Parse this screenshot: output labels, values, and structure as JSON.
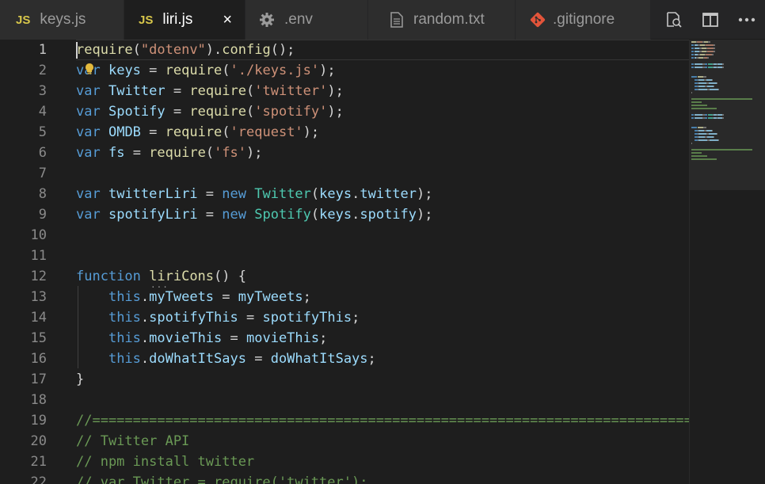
{
  "tabs": [
    {
      "label": "keys.js",
      "icon": "js-icon",
      "icon_text": "JS",
      "active": false
    },
    {
      "label": "liri.js",
      "icon": "js-icon",
      "icon_text": "JS",
      "active": true,
      "close_glyph": "×"
    },
    {
      "label": ".env",
      "icon": "gear-icon",
      "active": false
    },
    {
      "label": "random.txt",
      "icon": "file-text-icon",
      "active": false
    },
    {
      "label": ".gitignore",
      "icon": "git-icon",
      "active": false
    }
  ],
  "actions": [
    {
      "name": "open-changes-icon"
    },
    {
      "name": "split-editor-icon"
    },
    {
      "name": "more-actions-icon"
    }
  ],
  "colors": {
    "keyword": "#569cd6",
    "function": "#dcdcaa",
    "string": "#ce9178",
    "variable": "#9cdcfe",
    "class": "#4ec9b0",
    "comment": "#6a9955",
    "text": "#d4d4d4"
  },
  "editor": {
    "lines": [
      {
        "n": "1",
        "tokens": [
          [
            "fn",
            "require"
          ],
          [
            "pun",
            "("
          ],
          [
            "str",
            "\"dotenv\""
          ],
          [
            "pun",
            ")."
          ],
          [
            "fn",
            "config"
          ],
          [
            "pun",
            "();"
          ]
        ]
      },
      {
        "n": "2",
        "tokens": [
          [
            "kw",
            "var"
          ],
          [
            "pun",
            " "
          ],
          [
            "var",
            "keys"
          ],
          [
            "pun",
            " = "
          ],
          [
            "fn",
            "require"
          ],
          [
            "pun",
            "("
          ],
          [
            "str",
            "'./keys.js'"
          ],
          [
            "pun",
            ");"
          ]
        ]
      },
      {
        "n": "3",
        "tokens": [
          [
            "kw",
            "var"
          ],
          [
            "pun",
            " "
          ],
          [
            "var",
            "Twitter"
          ],
          [
            "pun",
            " = "
          ],
          [
            "fn",
            "require"
          ],
          [
            "pun",
            "("
          ],
          [
            "str",
            "'twitter'"
          ],
          [
            "pun",
            ");"
          ]
        ]
      },
      {
        "n": "4",
        "tokens": [
          [
            "kw",
            "var"
          ],
          [
            "pun",
            " "
          ],
          [
            "var",
            "Spotify"
          ],
          [
            "pun",
            " = "
          ],
          [
            "fn",
            "require"
          ],
          [
            "pun",
            "("
          ],
          [
            "str",
            "'spotify'"
          ],
          [
            "pun",
            ");"
          ]
        ]
      },
      {
        "n": "5",
        "tokens": [
          [
            "kw",
            "var"
          ],
          [
            "pun",
            " "
          ],
          [
            "var",
            "OMDB"
          ],
          [
            "pun",
            " = "
          ],
          [
            "fn",
            "require"
          ],
          [
            "pun",
            "("
          ],
          [
            "str",
            "'request'"
          ],
          [
            "pun",
            ");"
          ]
        ]
      },
      {
        "n": "6",
        "tokens": [
          [
            "kw",
            "var"
          ],
          [
            "pun",
            " "
          ],
          [
            "var",
            "fs"
          ],
          [
            "pun",
            " = "
          ],
          [
            "fn",
            "require"
          ],
          [
            "pun",
            "("
          ],
          [
            "str",
            "'fs'"
          ],
          [
            "pun",
            ");"
          ]
        ]
      },
      {
        "n": "7",
        "tokens": []
      },
      {
        "n": "8",
        "tokens": [
          [
            "kw",
            "var"
          ],
          [
            "pun",
            " "
          ],
          [
            "var",
            "twitterLiri"
          ],
          [
            "pun",
            " = "
          ],
          [
            "kw",
            "new"
          ],
          [
            "pun",
            " "
          ],
          [
            "cls",
            "Twitter"
          ],
          [
            "pun",
            "("
          ],
          [
            "var",
            "keys"
          ],
          [
            "pun",
            "."
          ],
          [
            "var",
            "twitter"
          ],
          [
            "pun",
            ");"
          ]
        ]
      },
      {
        "n": "9",
        "tokens": [
          [
            "kw",
            "var"
          ],
          [
            "pun",
            " "
          ],
          [
            "var",
            "spotifyLiri"
          ],
          [
            "pun",
            " = "
          ],
          [
            "kw",
            "new"
          ],
          [
            "pun",
            " "
          ],
          [
            "cls",
            "Spotify"
          ],
          [
            "pun",
            "("
          ],
          [
            "var",
            "keys"
          ],
          [
            "pun",
            "."
          ],
          [
            "var",
            "spotify"
          ],
          [
            "pun",
            ");"
          ]
        ]
      },
      {
        "n": "10",
        "tokens": []
      },
      {
        "n": "11",
        "tokens": []
      },
      {
        "n": "12",
        "tokens": [
          [
            "kw",
            "function"
          ],
          [
            "pun",
            " "
          ],
          [
            "fn",
            "liriCons"
          ],
          [
            "pun",
            "() {"
          ]
        ]
      },
      {
        "n": "13",
        "tokens": [
          [
            "pun",
            "    "
          ],
          [
            "kw",
            "this"
          ],
          [
            "pun",
            "."
          ],
          [
            "var",
            "myTweets"
          ],
          [
            "pun",
            " = "
          ],
          [
            "var",
            "myTweets"
          ],
          [
            "pun",
            ";"
          ]
        ]
      },
      {
        "n": "14",
        "tokens": [
          [
            "pun",
            "    "
          ],
          [
            "kw",
            "this"
          ],
          [
            "pun",
            "."
          ],
          [
            "var",
            "spotifyThis"
          ],
          [
            "pun",
            " = "
          ],
          [
            "var",
            "spotifyThis"
          ],
          [
            "pun",
            ";"
          ]
        ]
      },
      {
        "n": "15",
        "tokens": [
          [
            "pun",
            "    "
          ],
          [
            "kw",
            "this"
          ],
          [
            "pun",
            "."
          ],
          [
            "var",
            "movieThis"
          ],
          [
            "pun",
            " = "
          ],
          [
            "var",
            "movieThis"
          ],
          [
            "pun",
            ";"
          ]
        ]
      },
      {
        "n": "16",
        "tokens": [
          [
            "pun",
            "    "
          ],
          [
            "kw",
            "this"
          ],
          [
            "pun",
            "."
          ],
          [
            "var",
            "doWhatItSays"
          ],
          [
            "pun",
            " = "
          ],
          [
            "var",
            "doWhatItSays"
          ],
          [
            "pun",
            ";"
          ]
        ]
      },
      {
        "n": "17",
        "tokens": [
          [
            "pun",
            "}"
          ]
        ]
      },
      {
        "n": "18",
        "tokens": []
      },
      {
        "n": "19",
        "tokens": [
          [
            "com",
            "//==================================================================================="
          ]
        ]
      },
      {
        "n": "20",
        "tokens": [
          [
            "com",
            "// Twitter API"
          ]
        ]
      },
      {
        "n": "21",
        "tokens": [
          [
            "com",
            "// npm install twitter"
          ]
        ]
      },
      {
        "n": "22",
        "tokens": [
          [
            "com",
            "// var Twitter = require('twitter');"
          ]
        ]
      }
    ]
  }
}
